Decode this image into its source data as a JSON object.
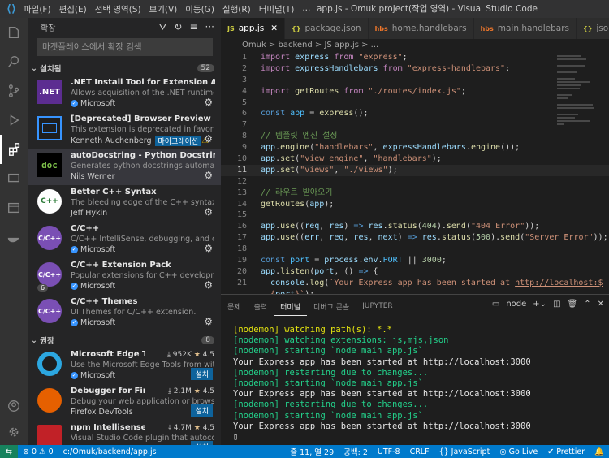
{
  "menu": [
    "파일(F)",
    "편집(E)",
    "선택 영역(S)",
    "보기(V)",
    "이동(G)",
    "실행(R)",
    "터미널(T)",
    "..."
  ],
  "window_title": "app.js - Omuk project(작업 영역) - Visual Studio Code",
  "sidebar": {
    "title": "확장",
    "search_placeholder": "마켓플레이스에서 확장 검색",
    "installed_label": "설치됨",
    "installed_count": "52",
    "installed": [
      {
        "name": ".NET Install Tool for Extension Authors",
        "desc": "Allows acquisition of the .NET runtime specifically for VS Code extension authors.",
        "publisher": "Microsoft",
        "icon": ".NET"
      },
      {
        "name": "[Deprecated] Browser Preview",
        "desc": "This extension is deprecated in favor of the built-in browser preview",
        "publisher": "Kenneth Auchenberg",
        "badge": "마이그레이션",
        "icon": "browser-preview-icon"
      },
      {
        "name": "autoDocstring - Python Docstring Generator",
        "desc": "Generates python docstrings automatically",
        "publisher": "Nils Werner",
        "icon": "doc"
      },
      {
        "name": "Better C++ Syntax",
        "desc": "The bleeding edge of the C++ syntax",
        "publisher": "Jeff Hykin",
        "icon": "C++"
      },
      {
        "name": "C/C++",
        "desc": "C/C++ IntelliSense, debugging, and code browsing.",
        "publisher": "Microsoft",
        "icon": "C/C++"
      },
      {
        "name": "C/C++ Extension Pack",
        "desc": "Popular extensions for C++ development in Visual Studio Code.",
        "publisher": "Microsoft",
        "icon": "C/C++",
        "count": "6"
      },
      {
        "name": "C/C++ Themes",
        "desc": "UI Themes for C/C++ extension.",
        "publisher": "Microsoft",
        "icon": "C/C++"
      }
    ],
    "recommended_label": "권장",
    "recommended_count": "8",
    "recommended": [
      {
        "name": "Microsoft Edge Tools for VS Code",
        "desc": "Use the Microsoft Edge Tools from within VS Code",
        "publisher": "Microsoft",
        "downloads": "952K",
        "rating": "4.5",
        "install": "설치"
      },
      {
        "name": "Debugger for Firefox",
        "desc": "Debug your web application or browser extension in Firefox",
        "publisher": "Firefox DevTools",
        "downloads": "2.1M",
        "rating": "4.5",
        "install": "설치"
      },
      {
        "name": "npm Intellisense",
        "desc": "Visual Studio Code plugin that autocompletes npm modules",
        "publisher": "",
        "downloads": "4.7M",
        "rating": "4.5",
        "install": "설치"
      }
    ]
  },
  "tabs": [
    {
      "label": "app.js",
      "icon": "JS"
    },
    {
      "label": "package.json",
      "icon": "{}"
    },
    {
      "label": "home.handlebars",
      "icon": "hbs"
    },
    {
      "label": "main.handlebars",
      "icon": "hbs"
    },
    {
      "label": "json",
      "icon": "{}"
    }
  ],
  "breadcrumb": "Omuk > backend > JS app.js > ...",
  "editor": {
    "current_line": 11,
    "line_numbers": [
      "1",
      "2",
      "3",
      "4",
      "5",
      "6",
      "7",
      "8",
      "9",
      "10",
      "11",
      "12",
      "13",
      "14",
      "15",
      "16",
      "17",
      "18",
      "19",
      "20",
      "21",
      ""
    ]
  },
  "panel": {
    "tabs": [
      "문제",
      "출력",
      "터미널",
      "디버그 콘솔",
      "JUPYTER"
    ],
    "active": "터미널",
    "shell": "node",
    "lines": [
      {
        "t": "[nodemon] watching path(s): *.*",
        "c": "y"
      },
      {
        "t": "[nodemon] watching extensions: js,mjs,json",
        "c": "g"
      },
      {
        "t": "[nodemon] starting `node main app.js`",
        "c": "g"
      },
      {
        "t": "Your Express app has been started at http://localhost:3000",
        "c": "w"
      },
      {
        "t": "[nodemon] restarting due to changes...",
        "c": "g"
      },
      {
        "t": "[nodemon] starting `node main app.js`",
        "c": "g"
      },
      {
        "t": "Your Express app has been started at http://localhost:3000",
        "c": "w"
      },
      {
        "t": "[nodemon] restarting due to changes...",
        "c": "g"
      },
      {
        "t": "[nodemon] starting `node main app.js`",
        "c": "g"
      },
      {
        "t": "Your Express app has been started at http://localhost:3000",
        "c": "w"
      },
      {
        "t": "▯",
        "c": "w"
      }
    ]
  },
  "status": {
    "errors": "⊗ 0 ⚠ 0",
    "path": "c:/Omuk/backend/app.js",
    "position": "줄 11, 열 29",
    "spaces": "공백: 2",
    "encoding": "UTF-8",
    "eol": "CRLF",
    "language": "{} JavaScript",
    "golive": "◎ Go Live",
    "prettier": "✔ Prettier"
  },
  "colors": {
    "accent": "#007acc",
    "terminal_green": "#23d18b",
    "terminal_yellow": "#e5e510"
  }
}
